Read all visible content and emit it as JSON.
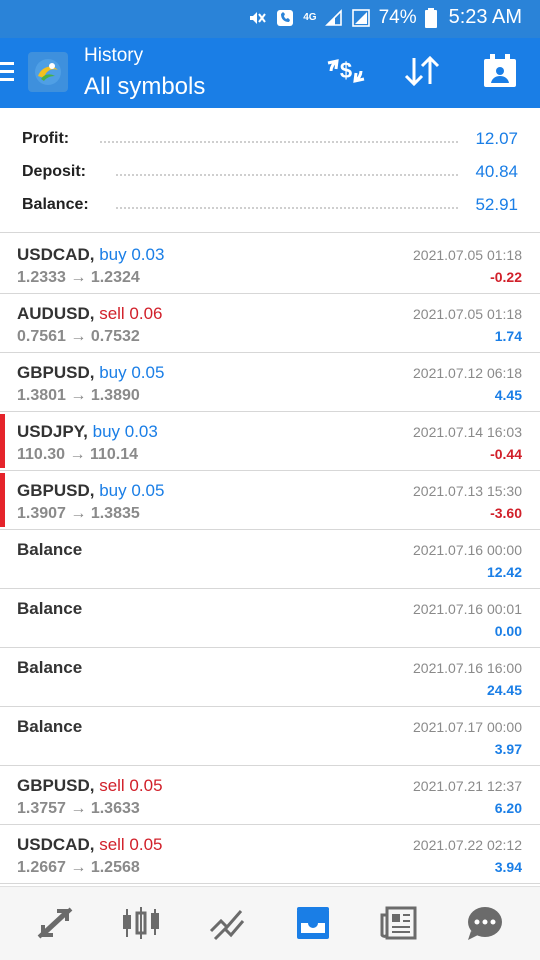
{
  "status_bar": {
    "icons": [
      "mute-icon",
      "call-icon",
      "4g-icon",
      "signal-icon",
      "battery-icon"
    ],
    "network": "4G",
    "battery": "74%",
    "time": "5:23 AM"
  },
  "app_bar": {
    "title": "History",
    "subtitle": "All symbols",
    "actions": [
      "currency-exchange-icon",
      "sort-icon",
      "calendar-icon"
    ]
  },
  "summary": {
    "profit_label": "Profit:",
    "profit_value": "12.07",
    "deposit_label": "Deposit:",
    "deposit_value": "40.84",
    "balance_label": "Balance:",
    "balance_value": "52.91"
  },
  "trades": [
    {
      "symbol": "USDCAD,",
      "direction": "buy 0.03",
      "prices": "1.2333 → 1.2324",
      "date": "2021.07.05 01:18",
      "profit": "-0.22"
    },
    {
      "symbol": "AUDUSD,",
      "direction": "sell 0.06",
      "prices": "0.7561 → 0.7532",
      "date": "2021.07.05 01:18",
      "profit": "1.74"
    },
    {
      "symbol": "GBPUSD,",
      "direction": "buy 0.05",
      "prices": "1.3801 → 1.3890",
      "date": "2021.07.12 06:18",
      "profit": "4.45"
    },
    {
      "symbol": "USDJPY,",
      "direction": "buy 0.03",
      "prices": "110.30 → 110.14",
      "date": "2021.07.14 16:03",
      "profit": "-0.44"
    },
    {
      "symbol": "GBPUSD,",
      "direction": "buy 0.05",
      "prices": "1.3907 → 1.3835",
      "date": "2021.07.13 15:30",
      "profit": "-3.60"
    },
    {
      "symbol": "Balance",
      "direction": "",
      "prices": "",
      "date": "2021.07.16 00:00",
      "profit": "12.42"
    },
    {
      "symbol": "Balance",
      "direction": "",
      "prices": "",
      "date": "2021.07.16 00:01",
      "profit": "0.00"
    },
    {
      "symbol": "Balance",
      "direction": "",
      "prices": "",
      "date": "2021.07.16 16:00",
      "profit": "24.45"
    },
    {
      "symbol": "Balance",
      "direction": "",
      "prices": "",
      "date": "2021.07.17 00:00",
      "profit": "3.97"
    },
    {
      "symbol": "GBPUSD,",
      "direction": "sell 0.05",
      "prices": "1.3757 → 1.3633",
      "date": "2021.07.21 12:37",
      "profit": "6.20"
    },
    {
      "symbol": "USDCAD,",
      "direction": "sell 0.05",
      "prices": "1.2667 → 1.2568",
      "date": "2021.07.22 02:12",
      "profit": "3.94"
    }
  ],
  "bottom_nav": {
    "items": [
      "quotes-icon",
      "chart-icon",
      "trade-icon",
      "history-icon",
      "news-icon",
      "chat-icon"
    ],
    "active": "history-icon"
  },
  "colors": {
    "accent": "#1a7ee6",
    "status_bar": "#2a83d8",
    "negative": "#d1202a",
    "marker": "#e5242b"
  }
}
